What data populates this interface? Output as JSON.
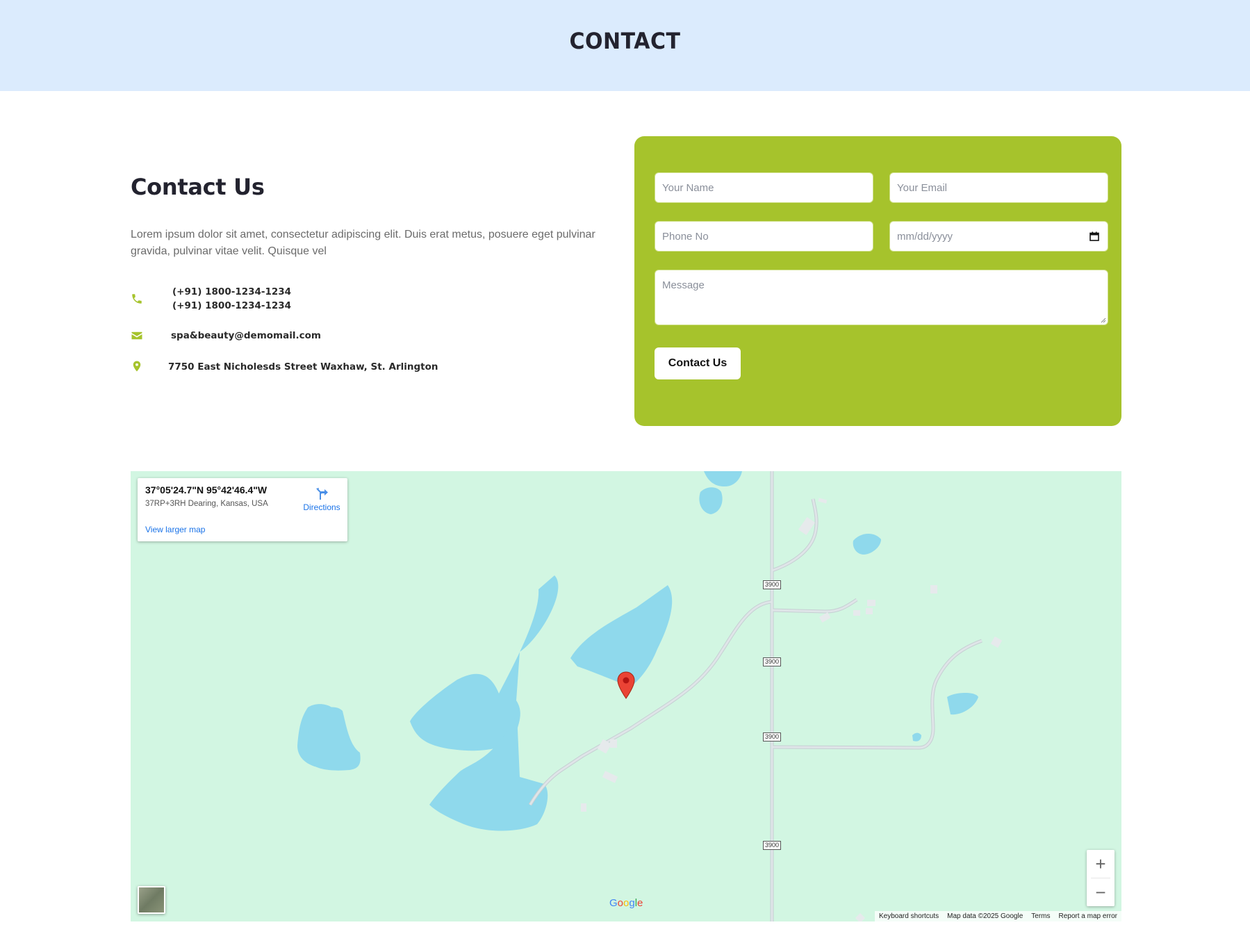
{
  "banner": {
    "title": "CONTACT"
  },
  "contact": {
    "heading": "Contact Us",
    "description": "Lorem ipsum dolor sit amet, consectetur adipiscing elit. Duis erat metus, posuere eget pulvinar gravida, pulvinar vitae velit. Quisque vel",
    "phone_1": "(+91) 1800-1234-1234",
    "phone_2": "(+91) 1800-1234-1234",
    "email": "spa&beauty@demomail.com",
    "address": "7750 East Nicholesds Street Waxhaw, St. Arlington",
    "icons": {
      "phone": "phone-icon",
      "email": "envelope-icon",
      "address": "map-pin-icon"
    },
    "accent_color": "#a6c32c"
  },
  "form": {
    "name_placeholder": "Your Name",
    "email_placeholder": "Your Email",
    "phone_placeholder": "Phone No",
    "date_placeholder": "mm/dd/yyyy",
    "message_placeholder": "Message",
    "submit_label": "Contact Us",
    "background_color": "#a6c32c"
  },
  "map": {
    "coordinates": "37°05'24.7\"N 95°42'46.4\"W",
    "plus_code": "37RP+3RH Dearing, Kansas, USA",
    "directions_label": "Directions",
    "larger_map_label": "View larger map",
    "route_label": "3900",
    "zoom_in": "+",
    "zoom_out": "−",
    "logo": "Google",
    "attribution": {
      "shortcuts": "Keyboard shortcuts",
      "data": "Map data ©2025 Google",
      "terms": "Terms",
      "report": "Report a map error"
    },
    "land_color": "#d2f6e2",
    "water_color": "#8fd9ec"
  }
}
